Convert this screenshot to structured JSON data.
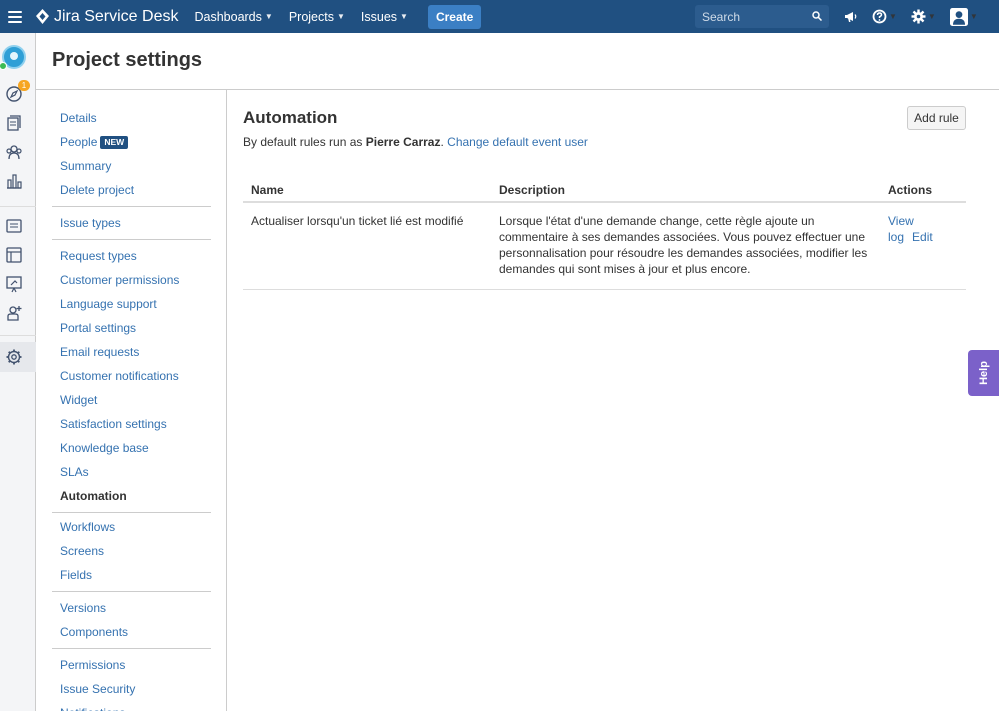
{
  "topbar": {
    "product_name": "Jira Service Desk",
    "nav": [
      {
        "label": "Dashboards"
      },
      {
        "label": "Projects"
      },
      {
        "label": "Issues"
      }
    ],
    "create_label": "Create",
    "search_placeholder": "Search",
    "icons": [
      "megaphone-icon",
      "help-icon",
      "settings-icon",
      "user-avatar-icon"
    ]
  },
  "rail": {
    "badge_count": "1",
    "icons": [
      "project-avatar",
      "compass-icon",
      "queues-icon",
      "customers-icon",
      "reports-icon",
      "knowledge-icon",
      "channels-icon",
      "raise-request-icon",
      "invite-team-icon",
      "project-settings-icon"
    ]
  },
  "header": {
    "title": "Project settings"
  },
  "sidebar": {
    "groups": [
      {
        "items": [
          {
            "label": "Details"
          },
          {
            "label": "People",
            "badge": "NEW"
          },
          {
            "label": "Summary"
          },
          {
            "label": "Delete project"
          }
        ]
      },
      {
        "items": [
          {
            "label": "Issue types"
          }
        ]
      },
      {
        "items": [
          {
            "label": "Request types"
          },
          {
            "label": "Customer permissions"
          },
          {
            "label": "Language support"
          },
          {
            "label": "Portal settings"
          },
          {
            "label": "Email requests"
          },
          {
            "label": "Customer notifications"
          },
          {
            "label": "Widget"
          },
          {
            "label": "Satisfaction settings"
          },
          {
            "label": "Knowledge base"
          },
          {
            "label": "SLAs"
          },
          {
            "label": "Automation",
            "active": true
          }
        ]
      },
      {
        "items": [
          {
            "label": "Workflows"
          },
          {
            "label": "Screens"
          },
          {
            "label": "Fields"
          }
        ]
      },
      {
        "items": [
          {
            "label": "Versions"
          },
          {
            "label": "Components"
          }
        ]
      },
      {
        "items": [
          {
            "label": "Permissions"
          },
          {
            "label": "Issue Security"
          },
          {
            "label": "Notifications"
          }
        ]
      }
    ]
  },
  "main": {
    "title": "Automation",
    "subtitle_prefix": "By default rules run as",
    "default_user": "Pierre Carraz",
    "subtitle_dot": ".",
    "change_link": "Change default event user",
    "add_rule_label": "Add rule",
    "table": {
      "headers": [
        "Name",
        "Description",
        "Actions"
      ],
      "rows": [
        {
          "name": "Actualiser lorsqu'un ticket lié est modifié",
          "description": "Lorsque l'état d'une demande change, cette règle ajoute un commentaire à ses demandes associées. Vous pouvez effectuer une personnalisation pour résoudre les demandes associées, modifier les demandes qui sont mises à jour et plus encore.",
          "actions": [
            "View log",
            "Edit"
          ]
        }
      ]
    }
  },
  "help_tab": {
    "label": "Help"
  },
  "colors": {
    "topbar": "#205081",
    "link": "#3572b0",
    "create_button": "#3b7fc4",
    "help_tab": "#7b61c9"
  }
}
